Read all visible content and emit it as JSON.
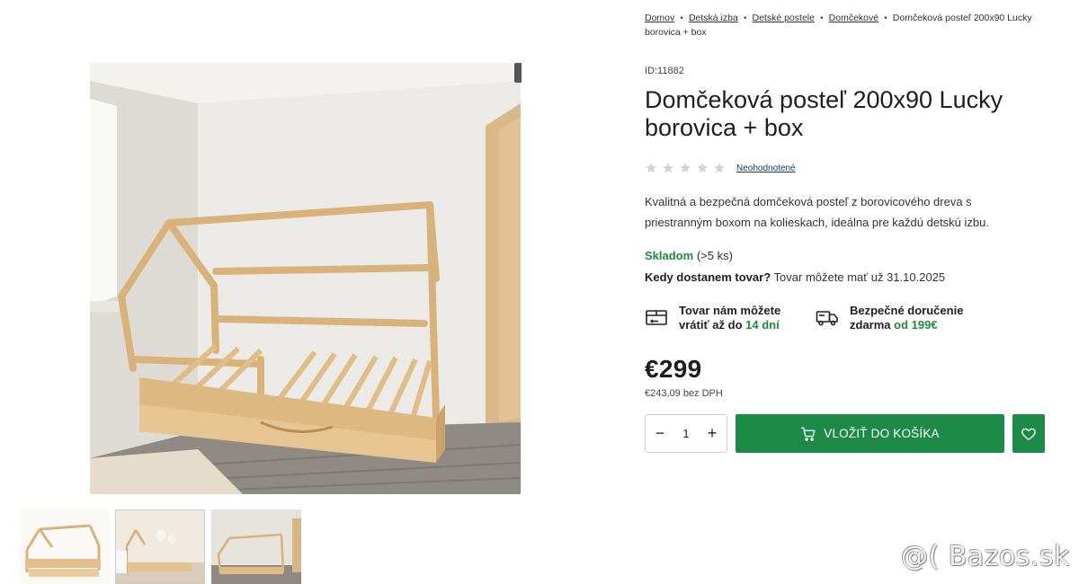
{
  "breadcrumb": {
    "items": [
      "Domov",
      "Detská izba",
      "Detské postele",
      "Domčekové"
    ],
    "separator": "•",
    "current": "Domčeková posteľ 200x90 Lucky borovica + box"
  },
  "product": {
    "id": "ID:11882",
    "title": "Domčeková posteľ 200x90 Lucky borovica + box",
    "rating": {
      "stars_filled": 0,
      "stars_total": 5,
      "label": "Neohodnotené"
    },
    "description": "Kvalitná a bezpečná domčeková posteľ z borovicového dreva s priestranným boxom na kolieskach, ideálna pre každú detskú izbu.",
    "stock": {
      "status": "Skladom",
      "count": "(>5 ks)"
    },
    "delivery": {
      "question": "Kedy dostanem tovar?",
      "answer": "Tovar môžete mať už 31.10.2025"
    },
    "benefits": [
      {
        "icon": "return-box-icon",
        "line1": "Tovar nám môžete",
        "line2_prefix": "vrátiť až do",
        "line2_highlight": "14 dní"
      },
      {
        "icon": "delivery-truck-icon",
        "line1": "Bezpečné doručenie",
        "line2_prefix": "zdarma",
        "line2_highlight": "od 199€"
      }
    ],
    "price": "€299",
    "price_net": "€243,09 bez DPH"
  },
  "cart": {
    "quantity": "1",
    "minus": "−",
    "plus": "+",
    "add_label": "VLOŽIŤ DO KOŠÍKA"
  },
  "watermark": "@( Bazos.sk",
  "colors": {
    "accent_green": "#1e8a48",
    "stock_green": "#1e8a3c",
    "text": "#1f1f1f",
    "star_empty": "#d3d3d3"
  }
}
